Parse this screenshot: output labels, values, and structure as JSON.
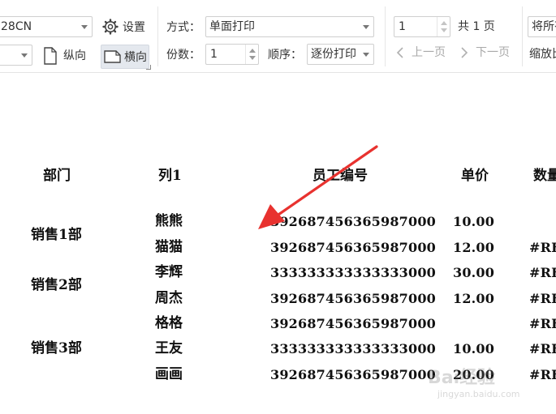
{
  "toolbar": {
    "printer_name": "28CN",
    "settings_label": "设置",
    "portrait_label": "纵向",
    "landscape_label": "横向",
    "mode_label": "方式：",
    "mode_value": "单面打印",
    "copies_label": "份数：",
    "copies_value": "1",
    "order_label": "顺序：",
    "order_value": "逐份打印",
    "page_value": "1",
    "total_pages": "共 1 页",
    "prev_page_label": "上一页",
    "next_page_label": "下一页",
    "scale_select_value": "将所有",
    "scale_label": "缩放比"
  },
  "table": {
    "headers": [
      "部门",
      "列1",
      "员工编号",
      "单价",
      "数量"
    ],
    "departments": [
      "销售1部",
      "销售2部",
      "销售3部"
    ],
    "names": [
      "熊熊",
      "猫猫",
      "李辉",
      "周杰",
      "格格",
      "王友",
      "画画"
    ],
    "ids": [
      "392687456365987000",
      "392687456365987000",
      "333333333333333000",
      "392687456365987000",
      "392687456365987000",
      "333333333333333000",
      "392687456365987000"
    ],
    "prices": [
      "10.00",
      "12.00",
      "30.00",
      "12.00",
      "",
      "10.00",
      "20.00"
    ],
    "quantities": [
      "",
      "#REF",
      "#REF",
      "#REF",
      "#REF",
      "#REF",
      "#REF"
    ]
  },
  "watermark": {
    "brand": "Bai经验",
    "url": "jingyan.baidu.com"
  },
  "colors": {
    "arrow": "#e8322f",
    "active_button_bg": "#e4e8ee",
    "border": "#cfcfcf"
  }
}
